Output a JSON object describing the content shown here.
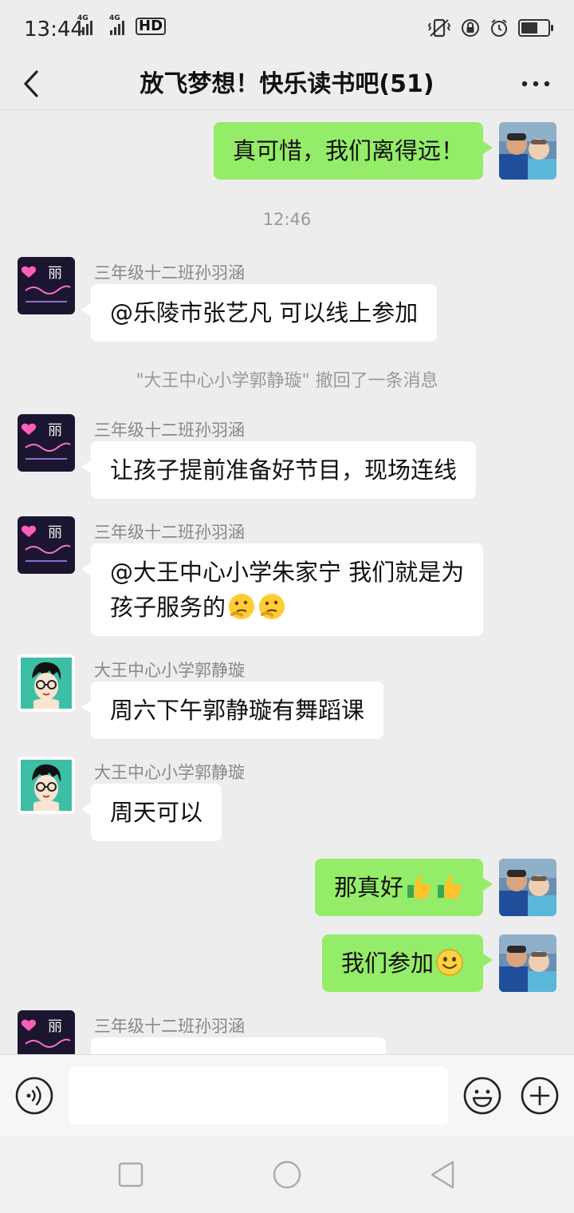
{
  "status_bar": {
    "time": "13:44",
    "network1": "4G",
    "network2": "4G",
    "hd": "HD",
    "icons": [
      "vibrate-icon",
      "rotation-lock-icon",
      "alarm-icon",
      "battery-icon"
    ]
  },
  "header": {
    "title": "放飞梦想！快乐读书吧(51)",
    "back_icon": "back-arrow-icon",
    "more_icon": "more-dots-icon"
  },
  "messages": [
    {
      "side": "right",
      "sender": "",
      "text": "真可惜，我们离得远！",
      "avatar": "kids-photo"
    },
    {
      "type": "time",
      "text": "12:46"
    },
    {
      "side": "left",
      "sender": "三年级十二班孙羽涵",
      "text": "@乐陵市张艺凡  可以线上参加",
      "avatar": "neon-heart"
    },
    {
      "type": "system",
      "text": "\"大王中心小学郭静璇\" 撤回了一条消息"
    },
    {
      "side": "left",
      "sender": "三年级十二班孙羽涵",
      "text": "让孩子提前准备好节目，现场连线",
      "avatar": "neon-heart"
    },
    {
      "side": "left",
      "sender": "三年级十二班孙羽涵",
      "text_line1": "@大王中心小学朱家宁  我们就是为",
      "text_line2": "孩子服务的",
      "emojis": [
        "thinking-emoji",
        "thinking-emoji"
      ],
      "avatar": "neon-heart"
    },
    {
      "side": "left",
      "sender": "大王中心小学郭静璇",
      "text": "周六下午郭静璇有舞蹈课",
      "avatar": "cartoon-boy"
    },
    {
      "side": "left",
      "sender": "大王中心小学郭静璇",
      "text": "周天可以",
      "avatar": "cartoon-boy"
    },
    {
      "side": "right",
      "text": "那真好",
      "emojis": [
        "thumbs-up-emoji",
        "thumbs-up-emoji"
      ],
      "avatar": "kids-photo"
    },
    {
      "side": "right",
      "text": "我们参加",
      "emojis": [
        "smile-emoji"
      ],
      "avatar": "kids-photo"
    },
    {
      "side": "left",
      "sender": "三年级十二班孙羽涵",
      "text": "",
      "avatar": "neon-heart"
    }
  ],
  "input_bar": {
    "voice_icon": "voice-icon",
    "input_value": "",
    "emoji_icon": "emoji-icon",
    "plus_icon": "plus-icon"
  },
  "nav_bar": {
    "icons": [
      "recent-apps-icon",
      "home-icon",
      "nav-back-icon"
    ]
  },
  "colors": {
    "background": "#ededed",
    "bubble_self": "#95ec69",
    "bubble_other": "#ffffff",
    "muted_text": "#888888"
  }
}
